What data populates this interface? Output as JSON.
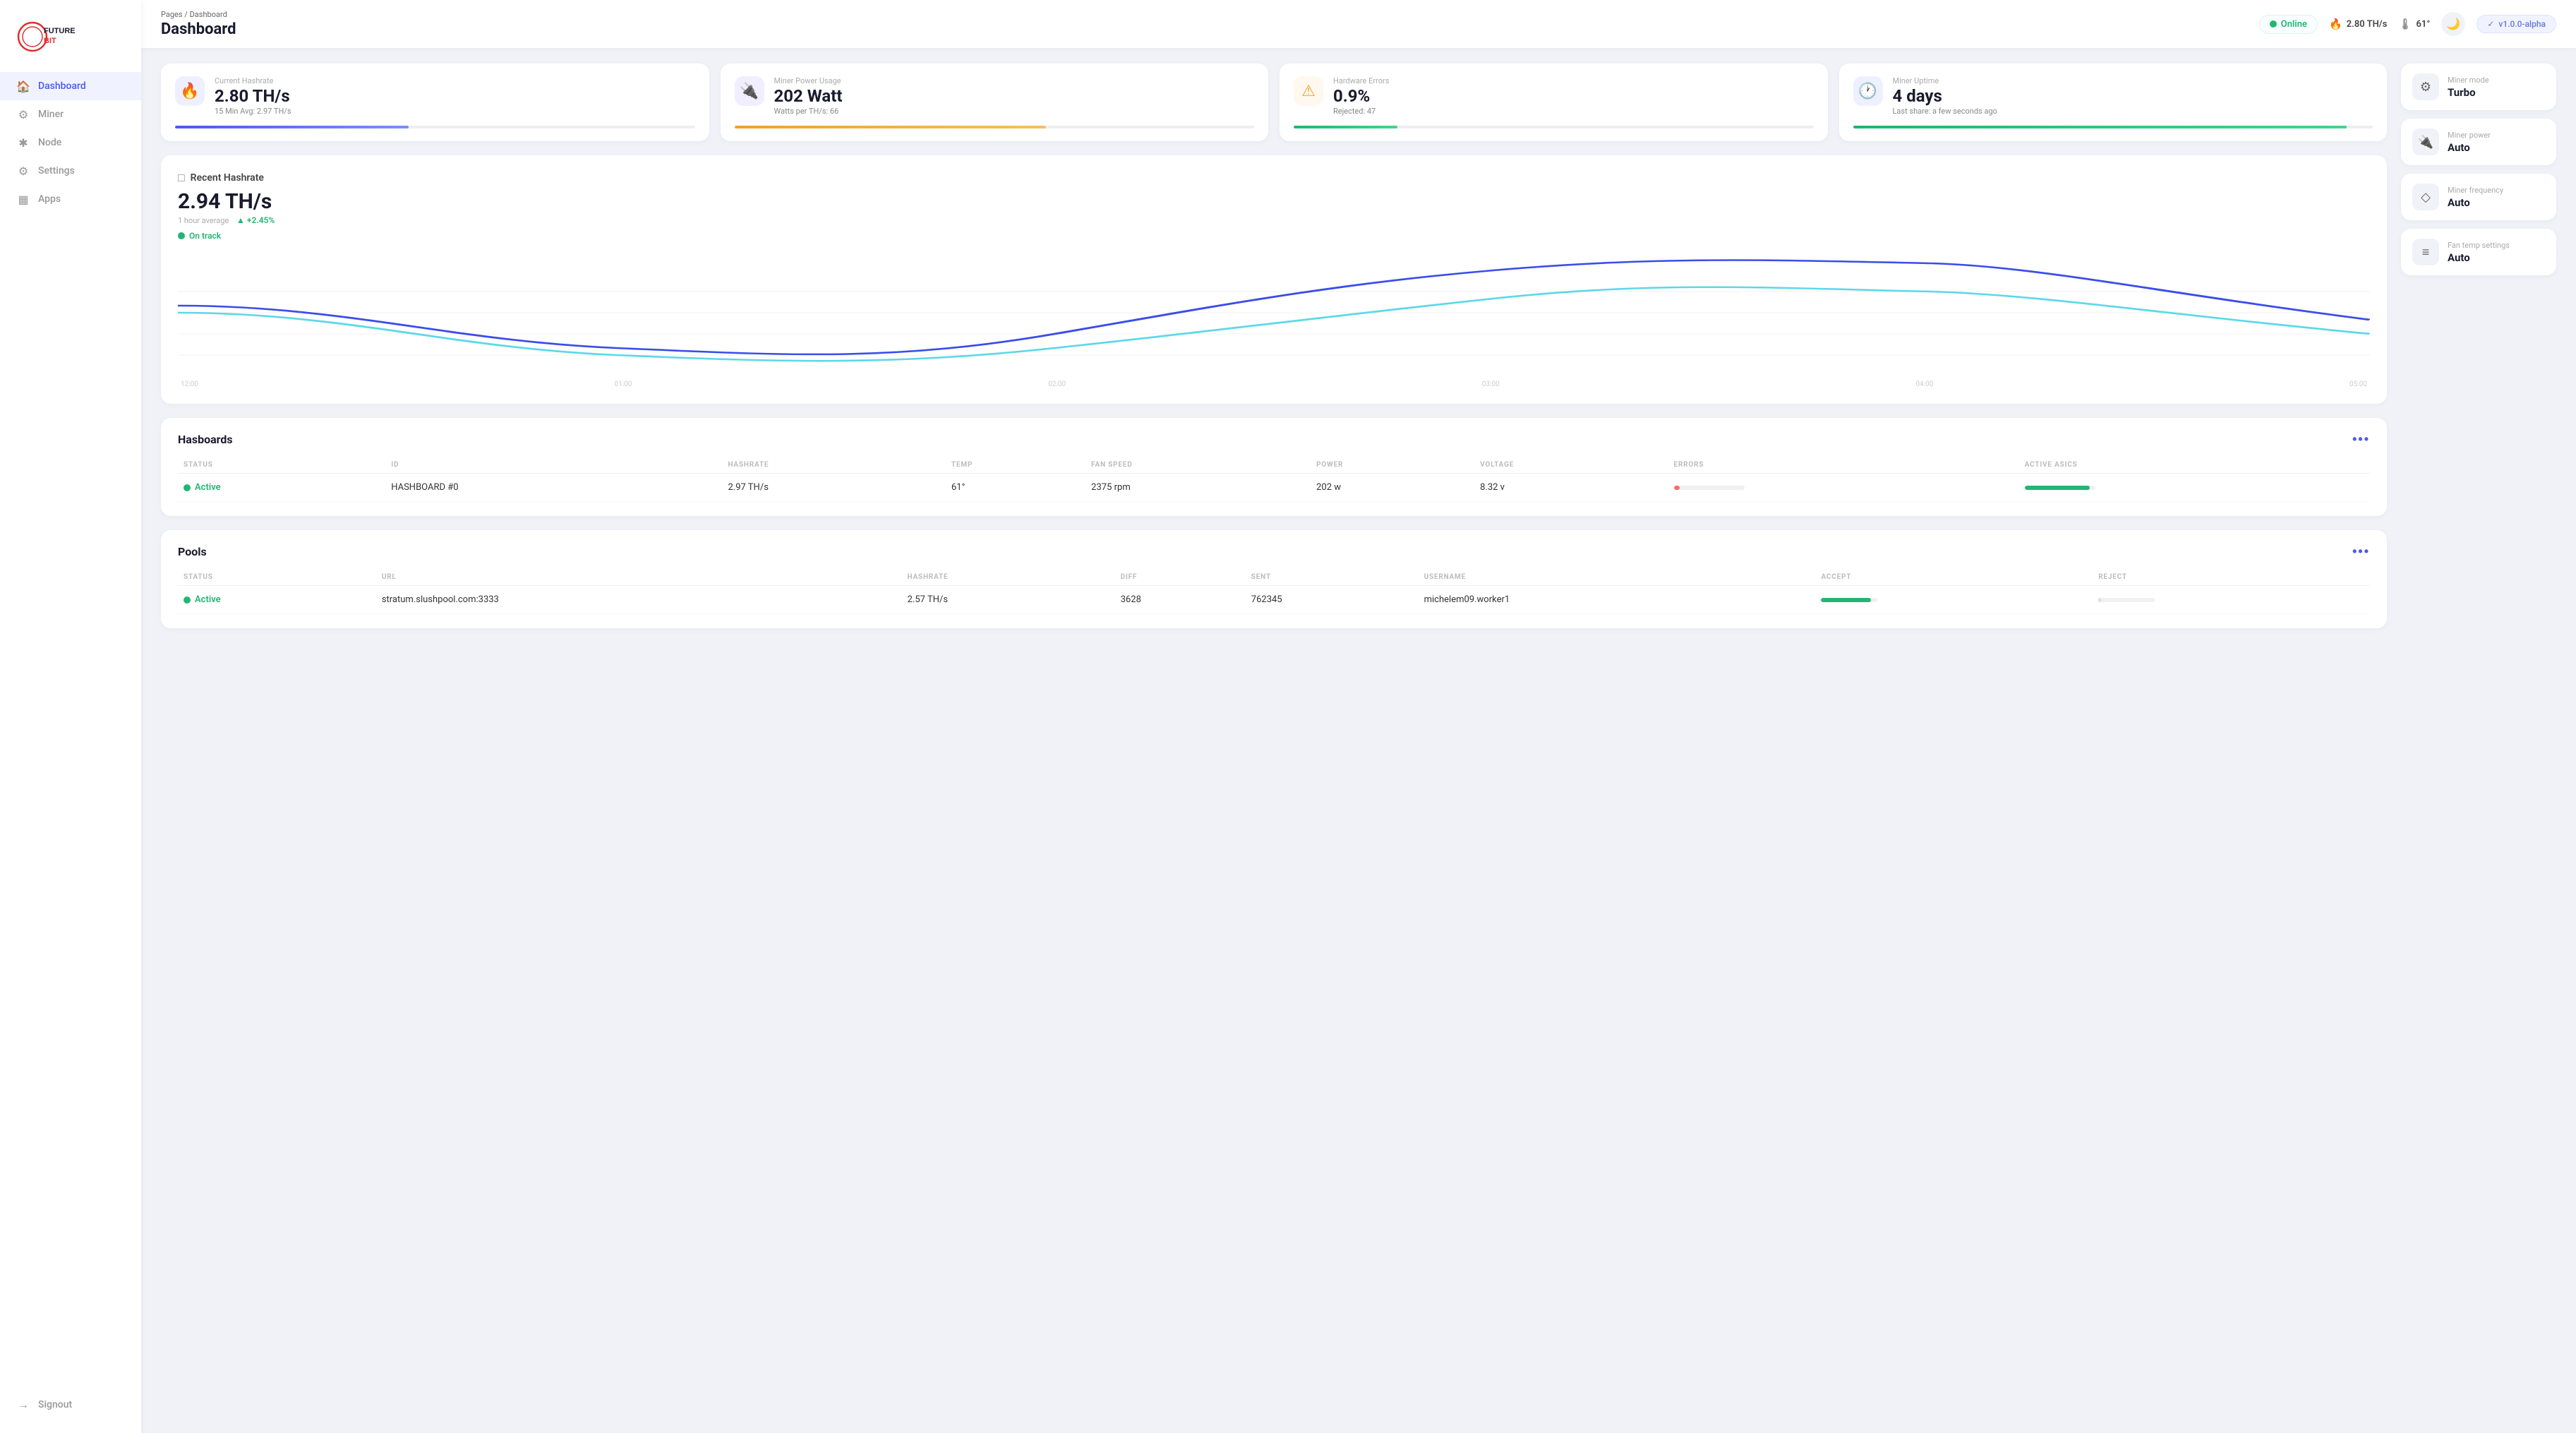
{
  "app": {
    "name": "FutureBit",
    "version": "v1.0.0-alpha"
  },
  "header": {
    "breadcrumb_pages": "Pages",
    "breadcrumb_sep": "/",
    "breadcrumb_current": "Dashboard",
    "title": "Dashboard",
    "status": "Online",
    "hashrate": "2.80 TH/s",
    "temp": "61°",
    "dark_mode_label": "Dark mode",
    "version": "v1.0.0-alpha"
  },
  "stats": [
    {
      "id": "hashrate",
      "label": "Current hashrate",
      "value": "2.80 TH/s",
      "sub_label": "15 Min Avg:",
      "sub_value": "2.97 TH/s",
      "icon": "🔥",
      "icon_class": "blue",
      "bar_class": "bar-blue"
    },
    {
      "id": "power",
      "label": "Miner power usage",
      "value": "202 Watt",
      "sub_label": "Watts per TH/s:",
      "sub_value": "66",
      "icon": "🔌",
      "icon_class": "purple",
      "bar_class": "bar-yellow"
    },
    {
      "id": "errors",
      "label": "Hardware errors",
      "value": "0.9%",
      "sub_label": "Rejected:",
      "sub_value": "47",
      "icon": "⚠",
      "icon_class": "yellow",
      "bar_class": "bar-green"
    },
    {
      "id": "uptime",
      "label": "Miner uptime",
      "value": "4 days",
      "sub_label": "Last share:",
      "sub_value": "a few seconds ago",
      "icon": "🕐",
      "icon_class": "indigo",
      "bar_class": "bar-green2"
    }
  ],
  "chart": {
    "title": "Recent Hashrate",
    "value": "2.94 TH/s",
    "period": "1 hour average",
    "change": "+2.45%",
    "status": "On track",
    "time_labels": [
      "12:00",
      "01:00",
      "02:00",
      "03:00",
      "04:00",
      "05:00"
    ]
  },
  "hasboards": {
    "title": "Hasboards",
    "columns": [
      "Status",
      "ID",
      "Hashrate",
      "Temp",
      "Fan Speed",
      "Power",
      "Voltage",
      "Errors",
      "Active ASICs"
    ],
    "rows": [
      {
        "status": "Active",
        "id": "HASHBOARD #0",
        "hashrate": "2.97 TH/s",
        "temp": "61°",
        "fan_speed": "2375 rpm",
        "power": "202 w",
        "voltage": "8.32 v",
        "errors_pct": 8,
        "asics_pct": 92
      }
    ]
  },
  "pools": {
    "title": "Pools",
    "columns": [
      "Status",
      "URL",
      "Hashrate",
      "Diff",
      "Sent",
      "Username",
      "Accept",
      "Reject"
    ],
    "rows": [
      {
        "status": "Active",
        "url": "stratum.slushpool.com:3333",
        "hashrate": "2.57 TH/s",
        "diff": "3628",
        "sent": "762345",
        "username": "michelem09.worker1",
        "accept_pct": 88,
        "reject_pct": 5
      }
    ]
  },
  "sidebar_nav": {
    "items": [
      {
        "id": "dashboard",
        "label": "Dashboard",
        "icon": "🏠",
        "active": true
      },
      {
        "id": "miner",
        "label": "Miner",
        "icon": "⚙",
        "active": false
      },
      {
        "id": "node",
        "label": "Node",
        "icon": "✱",
        "active": false
      },
      {
        "id": "settings",
        "label": "Settings",
        "icon": "⚙",
        "active": false
      },
      {
        "id": "apps",
        "label": "Apps",
        "icon": "▦",
        "active": false
      },
      {
        "id": "signout",
        "label": "Signout",
        "icon": "→",
        "active": false
      }
    ]
  },
  "right_panel": {
    "cards": [
      {
        "id": "miner_mode",
        "label": "Miner mode",
        "value": "Turbo",
        "icon": "⚙"
      },
      {
        "id": "miner_power",
        "label": "Miner power",
        "value": "Auto",
        "icon": "🔌"
      },
      {
        "id": "miner_frequency",
        "label": "Miner frequency",
        "value": "Auto",
        "icon": "◇"
      },
      {
        "id": "fan_temp",
        "label": "Fan temp settings",
        "value": "Auto",
        "icon": "≡"
      }
    ]
  }
}
